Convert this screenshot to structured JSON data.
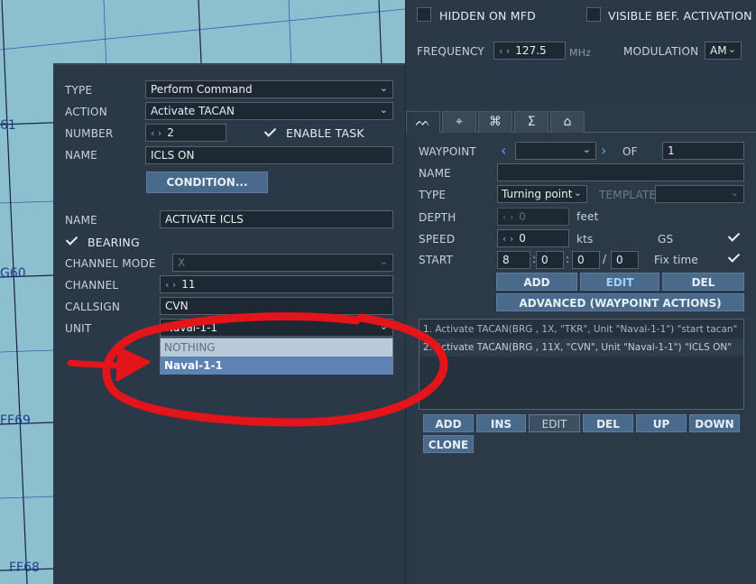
{
  "map": {
    "labels": [
      "61",
      "G60",
      "FF69",
      "FF68"
    ]
  },
  "task": {
    "type_label": "TYPE",
    "type_value": "Perform Command",
    "action_label": "ACTION",
    "action_value": "Activate TACAN",
    "number_label": "NUMBER",
    "number_value": "2",
    "enable_task_label": "ENABLE TASK",
    "enable_task_checked": true,
    "name_label": "NAME",
    "name_value": "ICLS ON",
    "condition_button": "CONDITION..."
  },
  "command": {
    "name_label": "NAME",
    "name_value": "ACTIVATE ICLS",
    "bearing_label": "BEARING",
    "bearing_checked": true,
    "channel_mode_label": "CHANNEL MODE",
    "channel_mode_value": "X",
    "channel_label": "CHANNEL",
    "channel_value": "11",
    "callsign_label": "CALLSIGN",
    "callsign_value": "CVN",
    "unit_label": "UNIT",
    "unit_value": "Naval-1-1",
    "unit_options": [
      "NOTHING",
      "Naval-1-1"
    ]
  },
  "radio": {
    "hidden_on_mfd_label": "HIDDEN ON MFD",
    "visible_before_activation_label": "VISIBLE BEF. ACTIVATION",
    "frequency_label": "FREQUENCY",
    "frequency_value": "127.5",
    "frequency_unit": "MHz",
    "modulation_label": "MODULATION",
    "modulation_value": "AM"
  },
  "tabs": [
    {
      "name": "route-icon",
      "glyph": "ᨓ"
    },
    {
      "name": "target-icon",
      "glyph": "⌖"
    },
    {
      "name": "network-icon",
      "glyph": "⌘"
    },
    {
      "name": "sum-icon",
      "glyph": "Σ"
    },
    {
      "name": "hangar-icon",
      "glyph": "⌂"
    }
  ],
  "waypoint": {
    "waypoint_label": "WAYPOINT",
    "waypoint_value": "",
    "of_label": "OF",
    "of_value": "1",
    "name_label": "NAME",
    "name_value": "",
    "type_label": "TYPE",
    "type_value": "Turning point",
    "template_label": "TEMPLATE",
    "template_value": "",
    "depth_label": "DEPTH",
    "depth_value": "0",
    "depth_unit": "feet",
    "speed_label": "SPEED",
    "speed_value": "0",
    "speed_unit": "kts",
    "gs_label": "GS",
    "gs_checked": true,
    "start_label": "START",
    "start_d": "8",
    "start_h": "0",
    "start_m": "0",
    "start_s": "0",
    "fix_time_label": "Fix time",
    "fix_time_checked": true,
    "add_button": "ADD",
    "edit_button": "EDIT",
    "del_button": "DEL",
    "advanced_button": "ADVANCED (WAYPOINT ACTIONS)"
  },
  "actions": {
    "rows": [
      "1. Activate TACAN(BRG , 1X, \"TKR\", Unit \"Naval-1-1\")  \"start tacan\"",
      "2. Activate TACAN(BRG , 11X, \"CVN\", Unit \"Naval-1-1\")  \"ICLS ON\""
    ],
    "add_button": "ADD",
    "ins_button": "INS",
    "edit_button": "EDIT",
    "del_button": "DEL",
    "up_button": "UP",
    "down_button": "DOWN",
    "clone_button": "CLONE"
  }
}
